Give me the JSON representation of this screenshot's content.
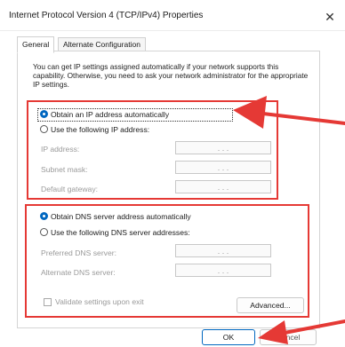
{
  "window": {
    "title": "Internet Protocol Version 4 (TCP/IPv4) Properties",
    "close_glyph": "✕"
  },
  "tabs": [
    {
      "label": "General",
      "active": true
    },
    {
      "label": "Alternate Configuration",
      "active": false
    }
  ],
  "description": "You can get IP settings assigned automatically if your network supports this capability. Otherwise, you need to ask your network administrator for the appropriate IP settings.",
  "ip_section": {
    "auto_label": "Obtain an IP address automatically",
    "manual_label": "Use the following IP address:",
    "selected": "auto",
    "fields": [
      {
        "label": "IP address:",
        "value": ".   .   ."
      },
      {
        "label": "Subnet mask:",
        "value": ".   .   ."
      },
      {
        "label": "Default gateway:",
        "value": ".   .   ."
      }
    ]
  },
  "dns_section": {
    "auto_label": "Obtain DNS server address automatically",
    "manual_label": "Use the following DNS server addresses:",
    "selected": "auto",
    "fields": [
      {
        "label": "Preferred DNS server:",
        "value": ".   .   ."
      },
      {
        "label": "Alternate DNS server:",
        "value": ".   .   ."
      }
    ]
  },
  "validate_label": "Validate settings upon exit",
  "validate_checked": false,
  "buttons": {
    "advanced": "Advanced...",
    "ok": "OK",
    "cancel": "Cancel"
  },
  "colors": {
    "accent": "#0067c0",
    "annotation_red": "#e53935"
  }
}
